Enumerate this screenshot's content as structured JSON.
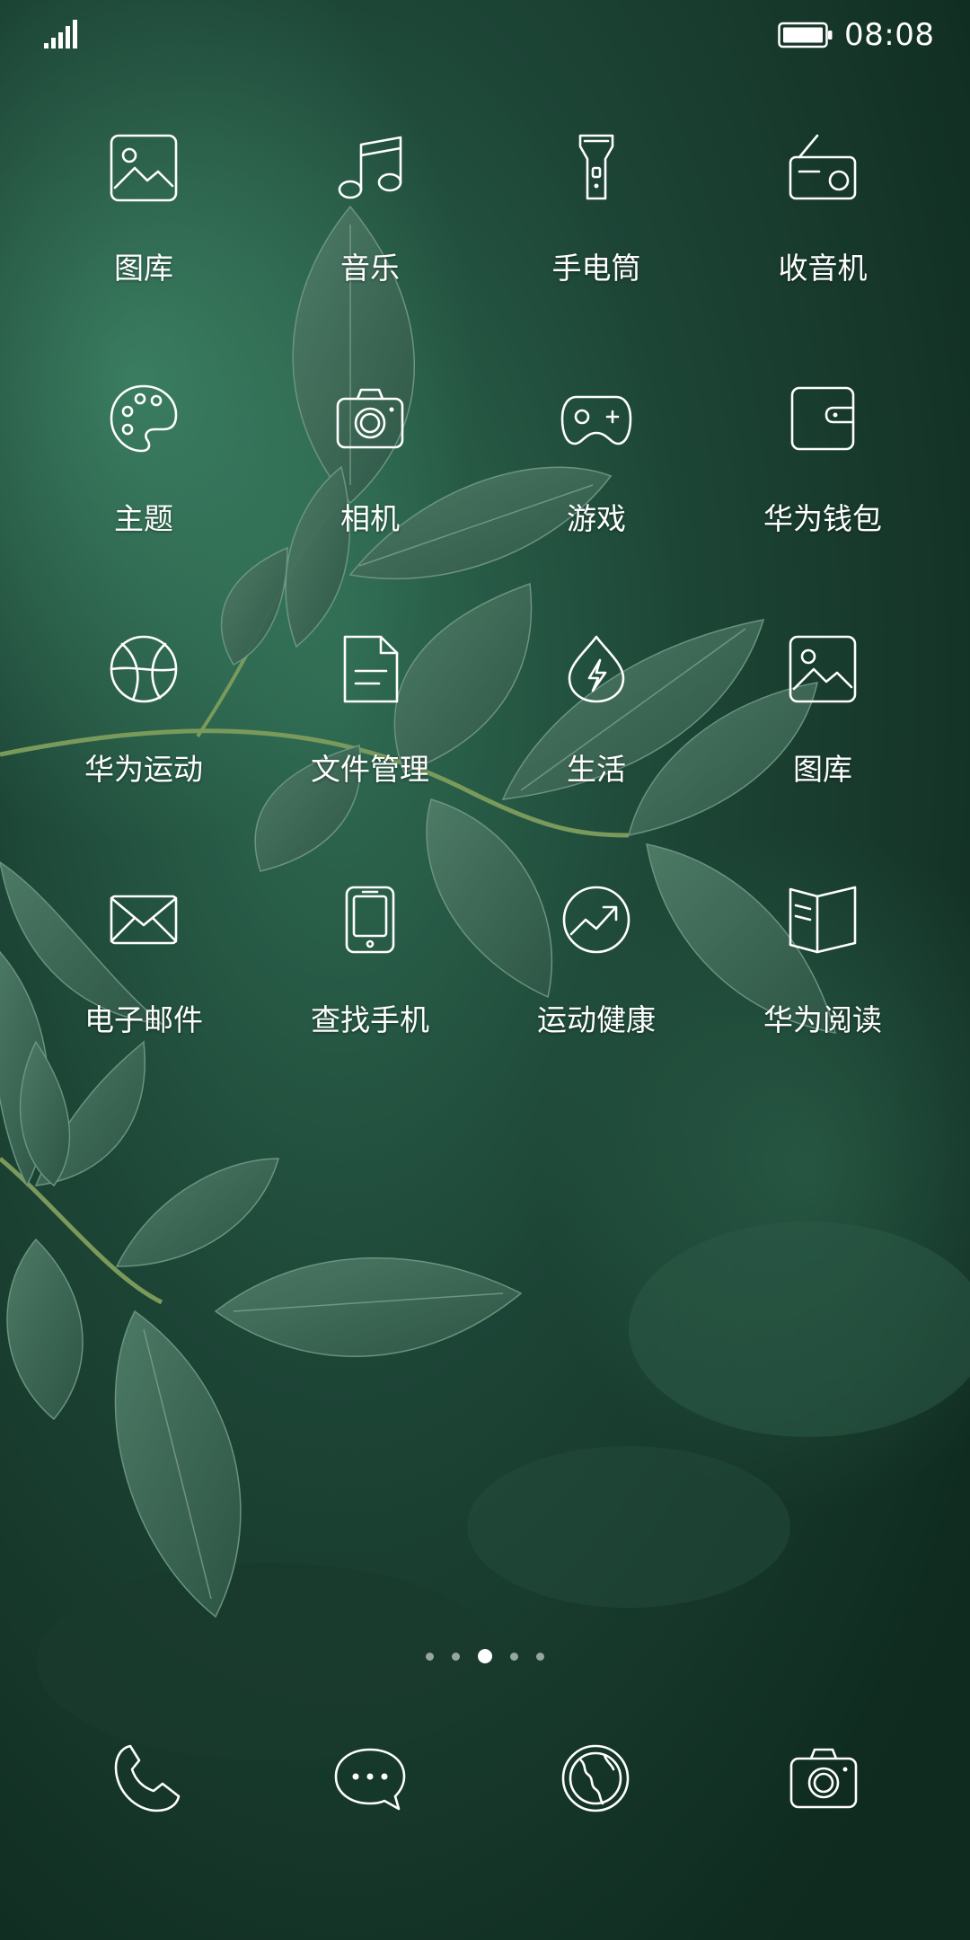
{
  "status_bar": {
    "time": "08:08",
    "signal_icon": "signal-bars-icon",
    "battery_icon": "battery-icon"
  },
  "apps": [
    {
      "label": "图库",
      "icon": "gallery-icon"
    },
    {
      "label": "音乐",
      "icon": "music-note-icon"
    },
    {
      "label": "手电筒",
      "icon": "flashlight-icon"
    },
    {
      "label": "收音机",
      "icon": "radio-icon"
    },
    {
      "label": "主题",
      "icon": "palette-icon"
    },
    {
      "label": "相机",
      "icon": "camera-icon"
    },
    {
      "label": "游戏",
      "icon": "gamepad-icon"
    },
    {
      "label": "华为钱包",
      "icon": "wallet-icon"
    },
    {
      "label": "华为运动",
      "icon": "ball-icon"
    },
    {
      "label": "文件管理",
      "icon": "document-icon"
    },
    {
      "label": "生活",
      "icon": "lightning-drop-icon"
    },
    {
      "label": "图库",
      "icon": "gallery-icon"
    },
    {
      "label": "电子邮件",
      "icon": "envelope-icon"
    },
    {
      "label": "查找手机",
      "icon": "phone-device-icon"
    },
    {
      "label": "运动健康",
      "icon": "trend-chart-icon"
    },
    {
      "label": "华为阅读",
      "icon": "book-icon"
    }
  ],
  "pager": {
    "page_count": 5,
    "current_page": 3
  },
  "dock": [
    {
      "icon": "phone-call-icon"
    },
    {
      "icon": "message-bubble-icon"
    },
    {
      "icon": "globe-icon"
    },
    {
      "icon": "camera-icon"
    }
  ],
  "colors": {
    "background": "#17382b",
    "foreground": "#ffffff",
    "leaf": "#3f6b58"
  }
}
